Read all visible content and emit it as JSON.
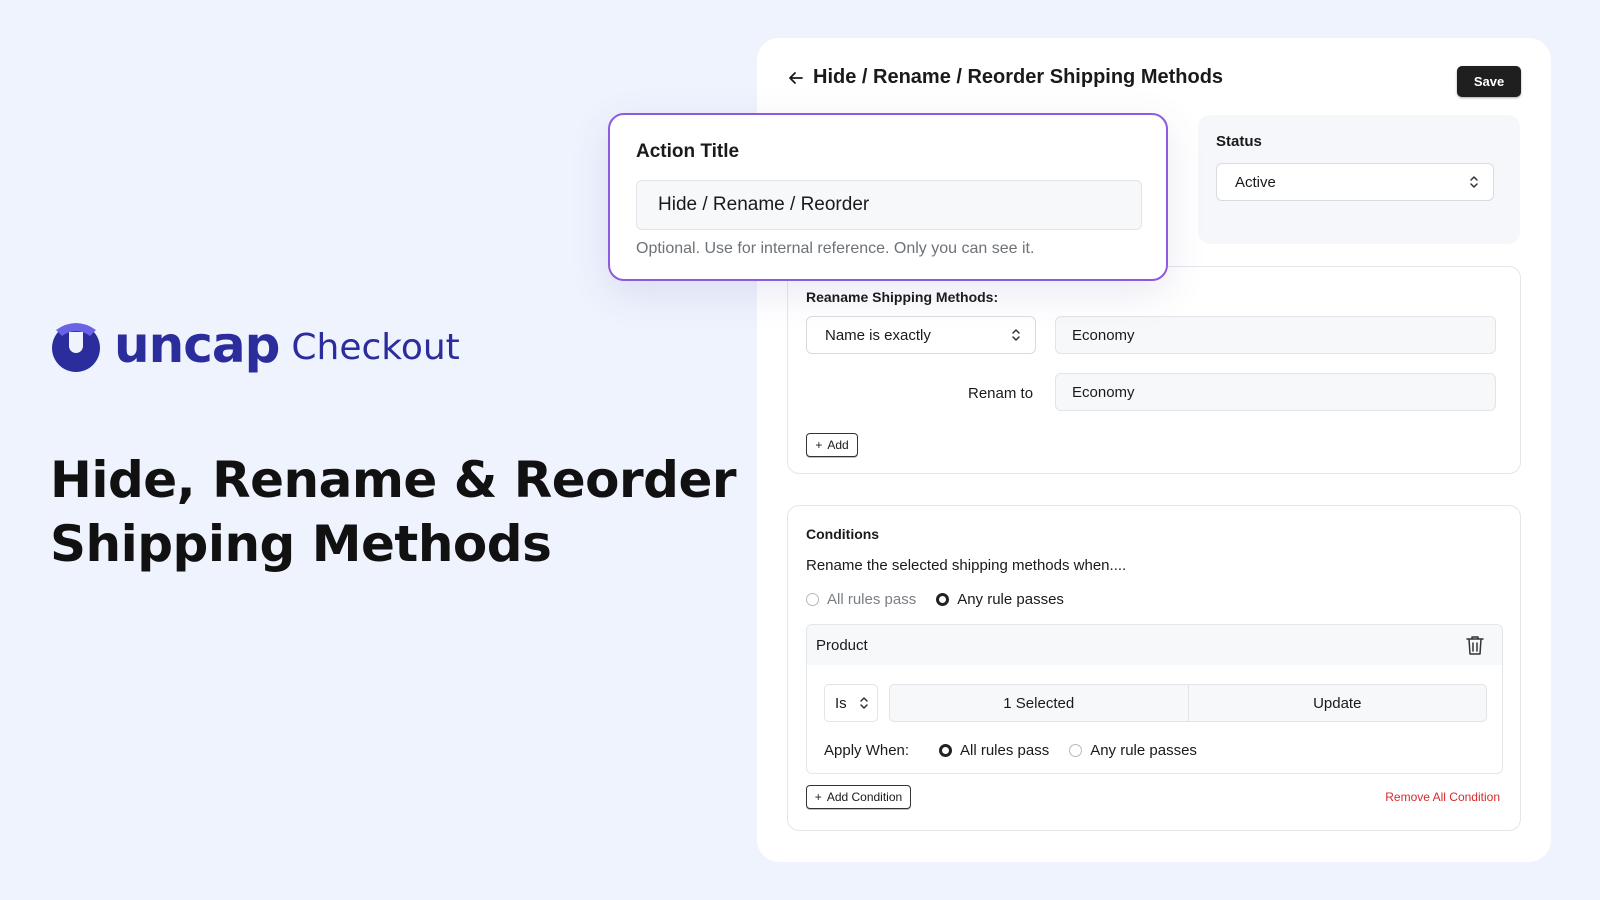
{
  "brand": {
    "wordmark": "uncap",
    "product": "Checkout",
    "color": "#2c2d9c",
    "logo_icon": "uncap-logo-icon"
  },
  "hero": {
    "line1": "Hide, Rename & Reorder",
    "line2": "Shipping Methods"
  },
  "header": {
    "title": "Hide / Rename / Reorder Shipping Methods",
    "back_icon": "arrow-left-icon",
    "save_label": "Save"
  },
  "status": {
    "label": "Status",
    "value": "Active"
  },
  "action_title": {
    "label": "Action Title",
    "value": "Hide / Rename / Reorder",
    "help": "Optional. Use for internal reference. Only you can see it."
  },
  "rename": {
    "label": "Reaname Shipping Methods:",
    "match_select": "Name is exactly",
    "name_value": "Economy",
    "rename_to_label": "Renam to",
    "rename_to_value": "Economy",
    "add_label": "Add"
  },
  "conditions": {
    "title": "Conditions",
    "description": "Rename the selected shipping methods when....",
    "mode_options": [
      {
        "label": "All rules pass",
        "selected": false
      },
      {
        "label": "Any rule passes",
        "selected": true
      }
    ],
    "rule": {
      "label": "Product",
      "operator": "Is",
      "selected_label": "1 Selected",
      "update_label": "Update",
      "apply_when_label": "Apply When:",
      "apply_options": [
        {
          "label": "All rules pass",
          "selected": true
        },
        {
          "label": "Any rule passes",
          "selected": false
        }
      ]
    },
    "add_condition_label": "Add Condition",
    "remove_all_label": "Remove All Condition"
  },
  "colors": {
    "accent_border": "#8d5be0",
    "danger": "#d42c2c",
    "background": "#eff3fd"
  }
}
